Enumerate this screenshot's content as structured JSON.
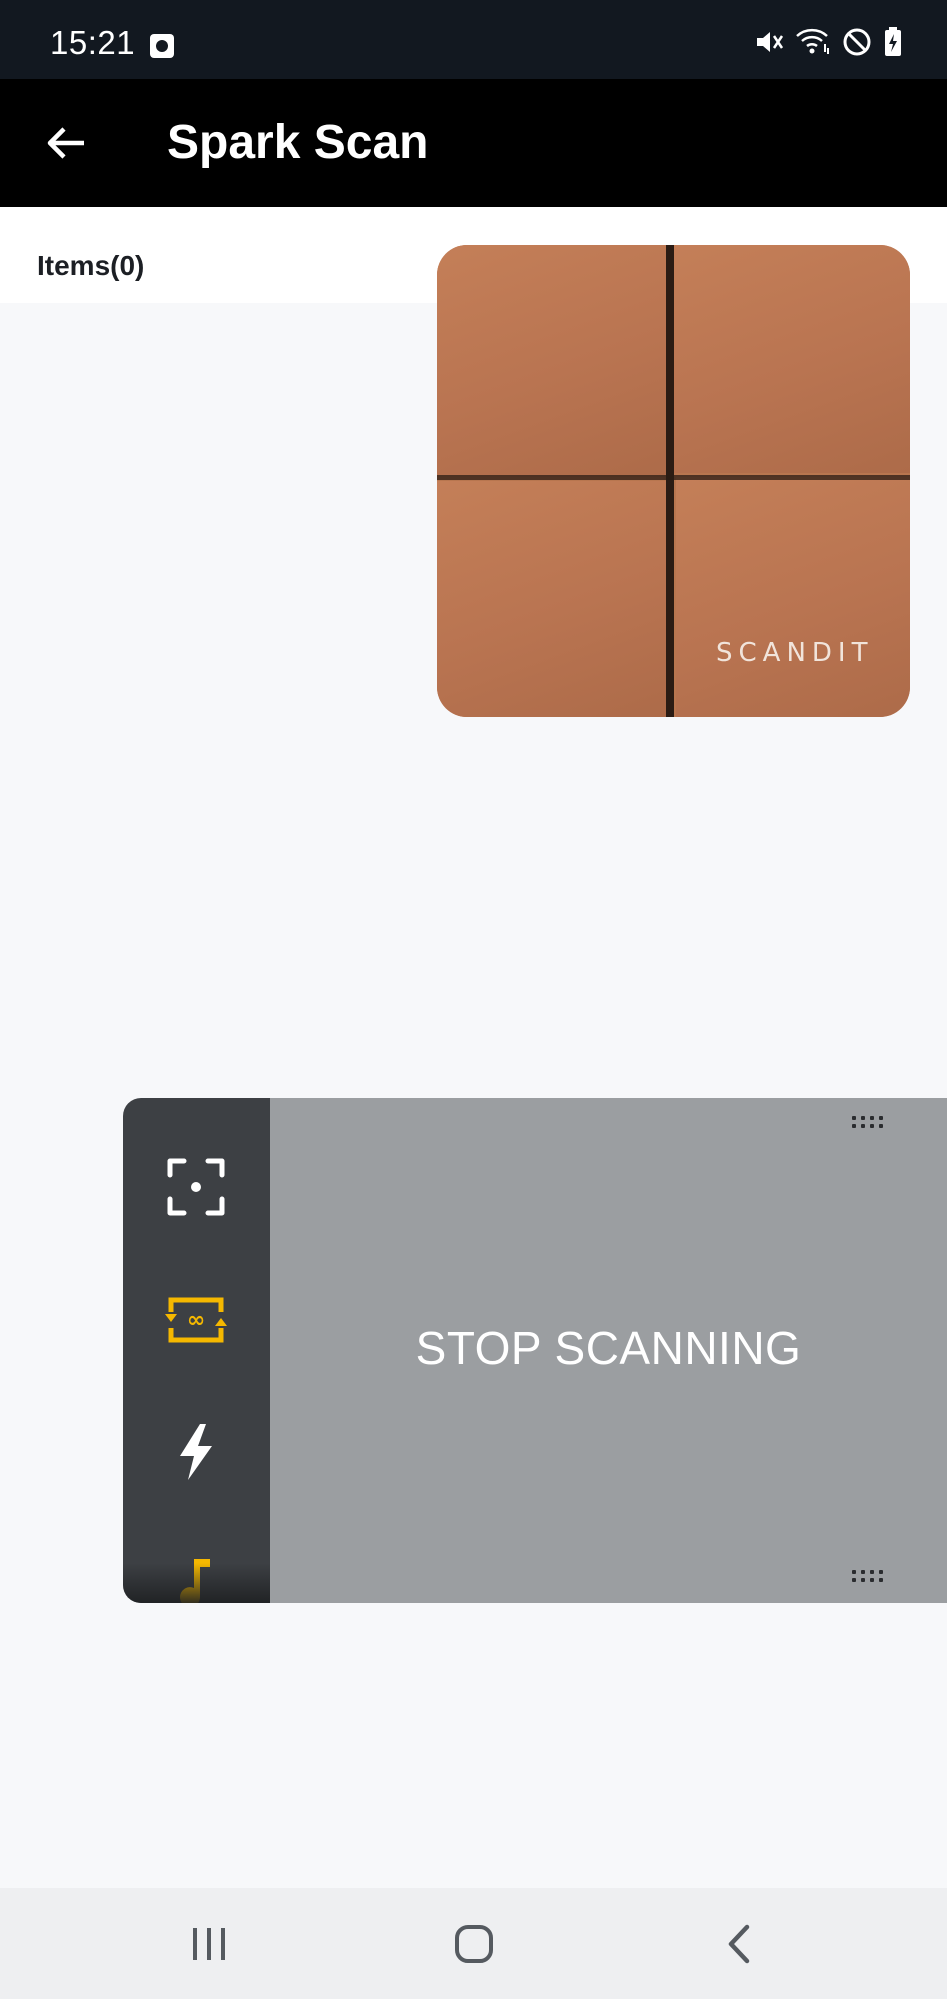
{
  "status_bar": {
    "time": "15:21",
    "icons": [
      "app-notification-icon",
      "mute-icon",
      "wifi-icon",
      "do-not-disturb-icon",
      "battery-charging-icon"
    ]
  },
  "app_bar": {
    "title": "Spark Scan",
    "back_icon": "arrow-left-icon"
  },
  "items": {
    "label": "Items(0)"
  },
  "camera": {
    "watermark": "SCANDIT"
  },
  "scanner": {
    "trigger_label": "STOP SCANNING",
    "tools": [
      {
        "name": "target-mode-icon",
        "color": "#ffffff"
      },
      {
        "name": "continuous-scan-icon",
        "color": "#f5b800"
      },
      {
        "name": "flash-icon",
        "color": "#ffffff"
      },
      {
        "name": "sound-icon",
        "color": "#f5b800"
      }
    ],
    "accent": "#f5b800"
  },
  "nav_bar": {
    "buttons": [
      "recent-apps-icon",
      "home-icon",
      "back-icon"
    ]
  }
}
